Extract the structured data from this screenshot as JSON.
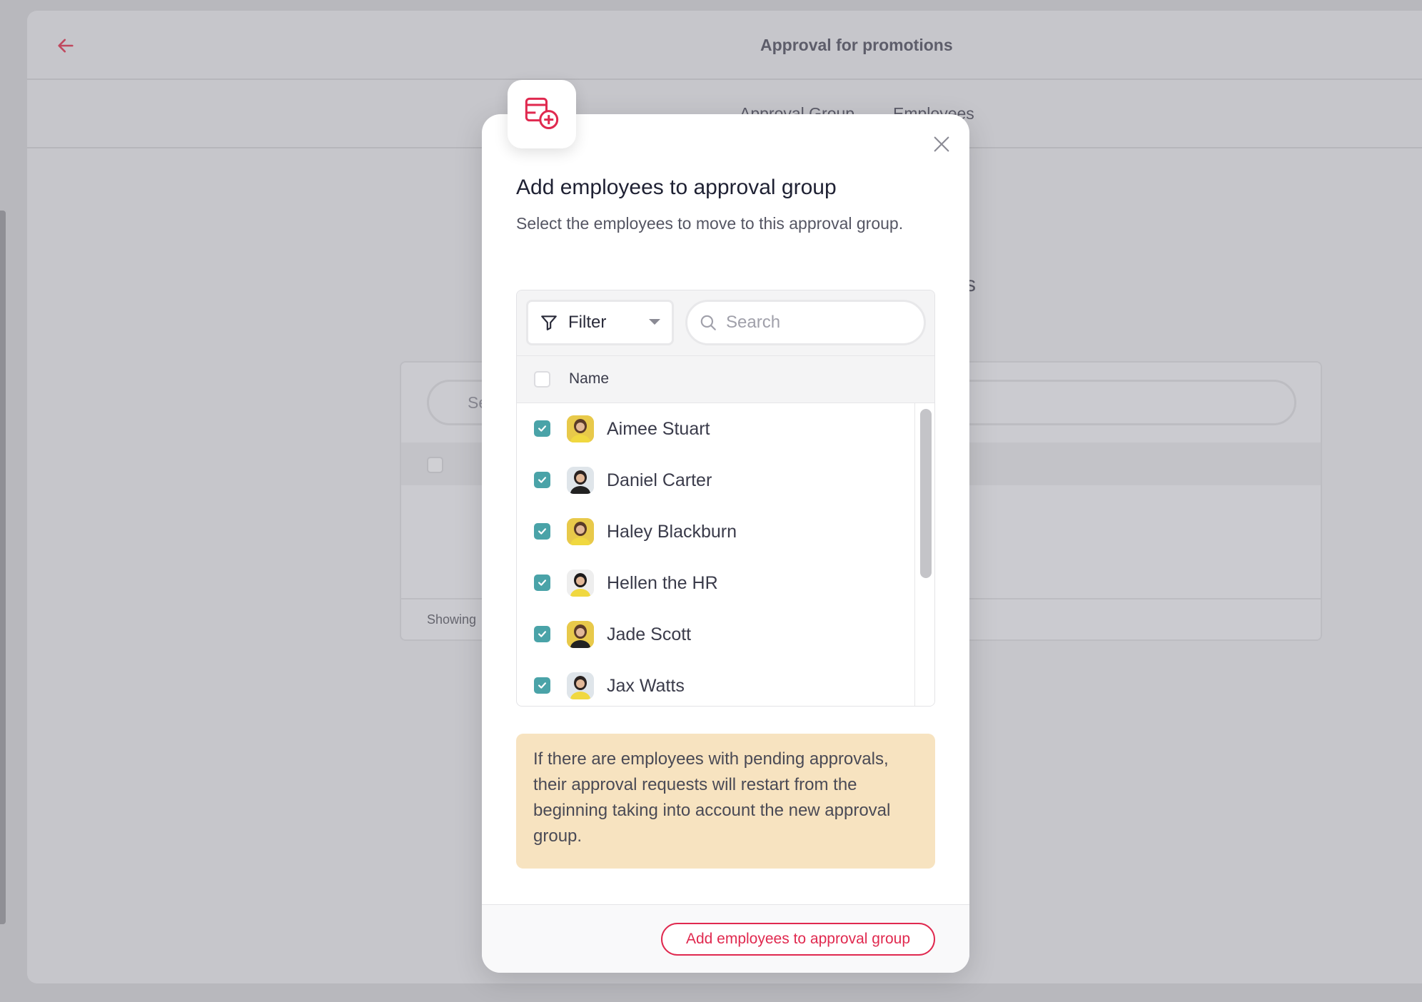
{
  "page": {
    "title": "Approval for promotions",
    "tabs": [
      {
        "label": "Approval Group"
      },
      {
        "label": "Employees"
      }
    ],
    "heading_fragment": "s",
    "search_fragment": "Se",
    "showing_label": "Showing"
  },
  "modal": {
    "icon": "add-to-list-icon",
    "title": "Add employees to approval group",
    "subtitle": "Select the employees to move to this approval group.",
    "filter_label": "Filter",
    "search_placeholder": "Search",
    "column_name": "Name",
    "employees": [
      {
        "name": "Aimee Stuart",
        "checked": true
      },
      {
        "name": "Daniel Carter",
        "checked": true
      },
      {
        "name": "Haley Blackburn",
        "checked": true
      },
      {
        "name": "Hellen the HR",
        "checked": true
      },
      {
        "name": "Jade Scott",
        "checked": true
      },
      {
        "name": "Jax Watts",
        "checked": true
      }
    ],
    "warning": "If there are employees with pending approvals, their approval requests will restart from the beginning taking into account the new approval group.",
    "submit_label": "Add employees to approval group"
  },
  "colors": {
    "accent": "#e0294f",
    "checkbox": "#4aa3a8",
    "warning_bg": "#f7e3c0"
  }
}
